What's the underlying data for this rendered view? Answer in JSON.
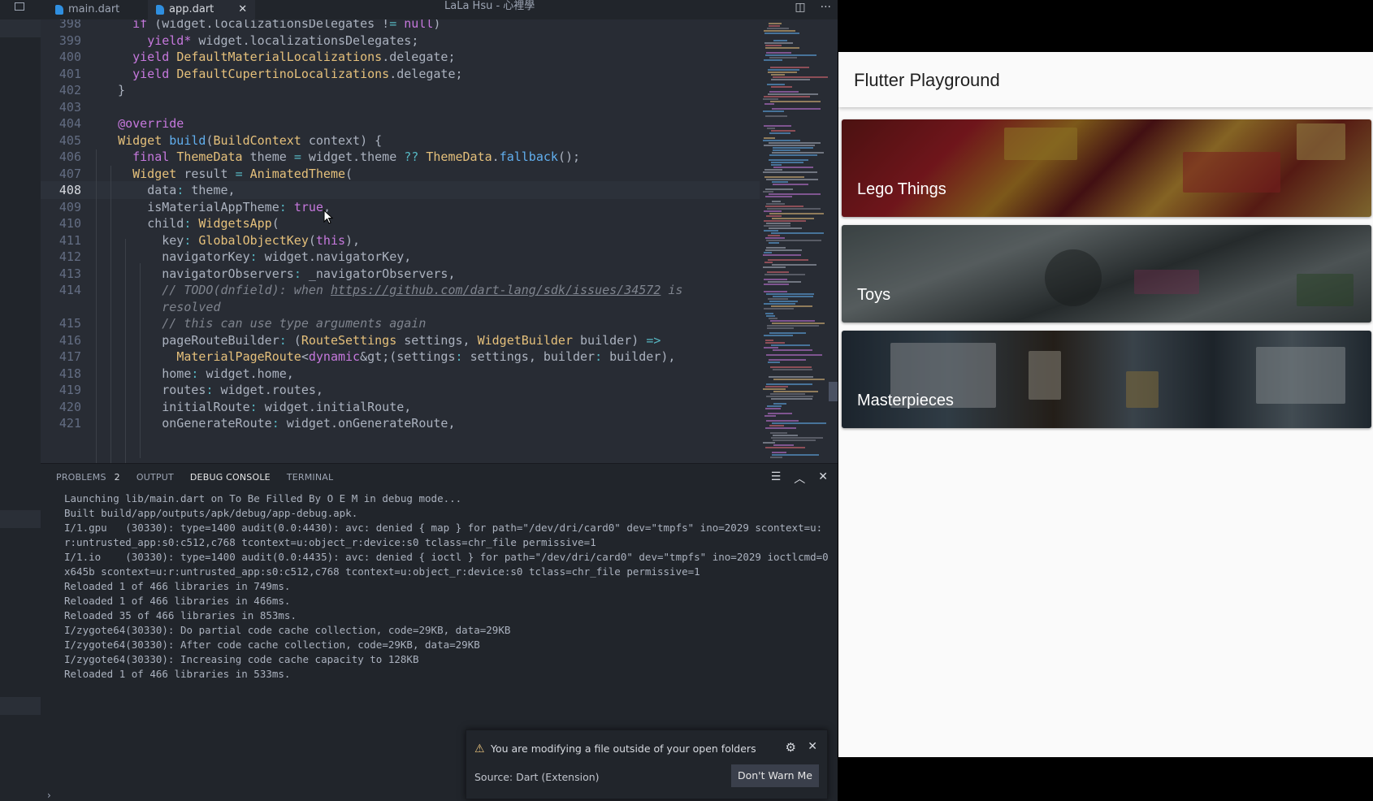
{
  "titlebar": {
    "tabs": [
      {
        "label": "main.dart",
        "active": false
      },
      {
        "label": "app.dart",
        "active": true
      }
    ],
    "close_glyph": "✕",
    "window_title": "LaLa Hsu - 心裡學",
    "icons": [
      "split-editor-icon",
      "more-actions-icon"
    ]
  },
  "editor": {
    "active_line": "408",
    "lines": [
      {
        "n": "398",
        "code": "    if (widget.localizationsDelegates != null)"
      },
      {
        "n": "399",
        "code": "      yield* widget.localizationsDelegates;"
      },
      {
        "n": "400",
        "code": "    yield DefaultMaterialLocalizations.delegate;"
      },
      {
        "n": "401",
        "code": "    yield DefaultCupertinoLocalizations.delegate;"
      },
      {
        "n": "402",
        "code": "  }"
      },
      {
        "n": "403",
        "code": ""
      },
      {
        "n": "404",
        "code": "  @override"
      },
      {
        "n": "405",
        "code": "  Widget build(BuildContext context) {"
      },
      {
        "n": "406",
        "code": "    final ThemeData theme = widget.theme ?? ThemeData.fallback();"
      },
      {
        "n": "407",
        "code": "    Widget result = AnimatedTheme("
      },
      {
        "n": "408",
        "code": "      data: theme,"
      },
      {
        "n": "409",
        "code": "      isMaterialAppTheme: true,"
      },
      {
        "n": "410",
        "code": "      child: WidgetsApp("
      },
      {
        "n": "411",
        "code": "        key: GlobalObjectKey(this),"
      },
      {
        "n": "412",
        "code": "        navigatorKey: widget.navigatorKey,"
      },
      {
        "n": "413",
        "code": "        navigatorObservers: _navigatorObservers,"
      },
      {
        "n": "414",
        "code": "        // TODO(dnfield): when https://github.com/dart-lang/sdk/issues/34572 is"
      },
      {
        "n": "",
        "code": "        resolved"
      },
      {
        "n": "415",
        "code": "        // this can use type arguments again"
      },
      {
        "n": "416",
        "code": "        pageRouteBuilder: (RouteSettings settings, WidgetBuilder builder) =>"
      },
      {
        "n": "417",
        "code": "          MaterialPageRoute<dynamic>(settings: settings, builder: builder),"
      },
      {
        "n": "418",
        "code": "        home: widget.home,"
      },
      {
        "n": "419",
        "code": "        routes: widget.routes,"
      },
      {
        "n": "420",
        "code": "        initialRoute: widget.initialRoute,"
      },
      {
        "n": "421",
        "code": "        onGenerateRoute: widget.onGenerateRoute,"
      }
    ]
  },
  "panel": {
    "tabs": [
      {
        "label": "PROBLEMS",
        "badge": "2"
      },
      {
        "label": "OUTPUT"
      },
      {
        "label": "DEBUG CONSOLE",
        "active": true
      },
      {
        "label": "TERMINAL"
      }
    ],
    "actions": [
      "clear-console-icon",
      "maximize-panel-icon",
      "close-panel-icon"
    ],
    "console_lines": [
      "Launching lib/main.dart on To Be Filled By O E M in debug mode...",
      "Built build/app/outputs/apk/debug/app-debug.apk.",
      "I/1.gpu   (30330): type=1400 audit(0.0:4430): avc: denied { map } for path=\"/dev/dri/card0\" dev=\"tmpfs\" ino=2029 scontext=u:r:untrusted_app:s0:c512,c768 tcontext=u:object_r:device:s0 tclass=chr_file permissive=1",
      "I/1.io    (30330): type=1400 audit(0.0:4435): avc: denied { ioctl } for path=\"/dev/dri/card0\" dev=\"tmpfs\" ino=2029 ioctlcmd=0x645b scontext=u:r:untrusted_app:s0:c512,c768 tcontext=u:object_r:device:s0 tclass=chr_file permissive=1",
      "Reloaded 1 of 466 libraries in 749ms.",
      "Reloaded 1 of 466 libraries in 466ms.",
      "Reloaded 35 of 466 libraries in 853ms.",
      "I/zygote64(30330): Do partial code cache collection, code=29KB, data=29KB",
      "I/zygote64(30330): After code cache collection, code=29KB, data=29KB",
      "I/zygote64(30330): Increasing code cache capacity to 128KB",
      "Reloaded 1 of 466 libraries in 533ms."
    ],
    "prompt": "›"
  },
  "notification": {
    "message": "You are modifying a file outside of your open folders",
    "source": "Source: Dart (Extension)",
    "button": "Don't Warn Me",
    "close": "✕"
  },
  "app": {
    "title": "Flutter Playground",
    "cards": [
      {
        "label": "Lego Things"
      },
      {
        "label": "Toys"
      },
      {
        "label": "Masterpieces"
      }
    ]
  },
  "colors": {
    "editor_bg": "#282c34",
    "panel_bg": "#21252b",
    "keyword": "#c678dd",
    "type": "#e5c07b",
    "function": "#61afef",
    "app_bg": "#fafafa"
  }
}
